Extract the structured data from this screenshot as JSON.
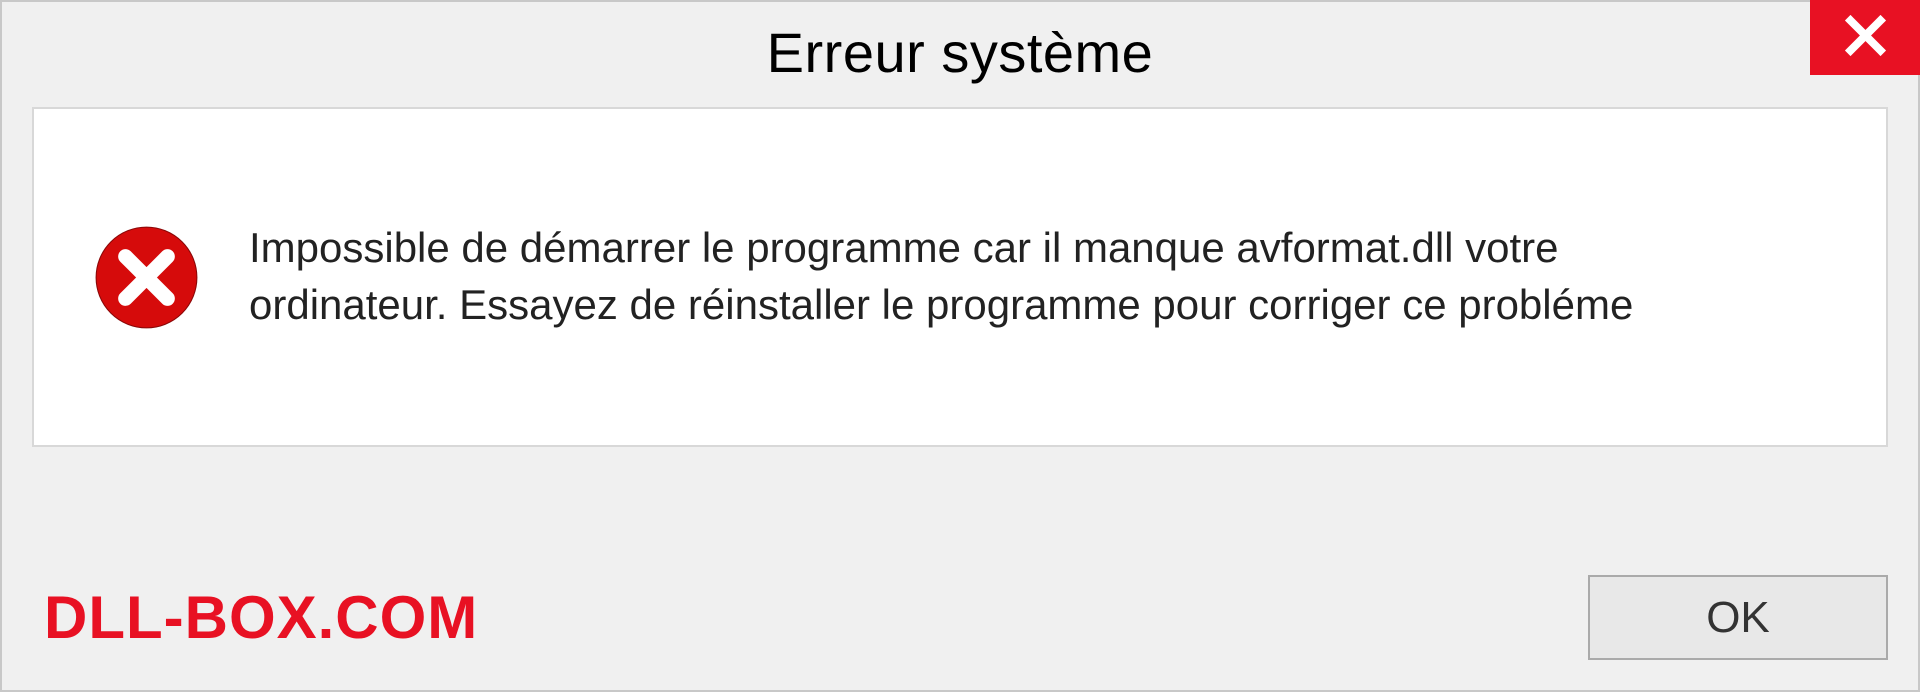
{
  "dialog": {
    "title": "Erreur système",
    "message": "Impossible de démarrer le programme car il manque avformat.dll votre ordinateur. Essayez de réinstaller le programme pour corriger ce probléme",
    "ok_label": "OK"
  },
  "watermark": "DLL-BOX.COM"
}
